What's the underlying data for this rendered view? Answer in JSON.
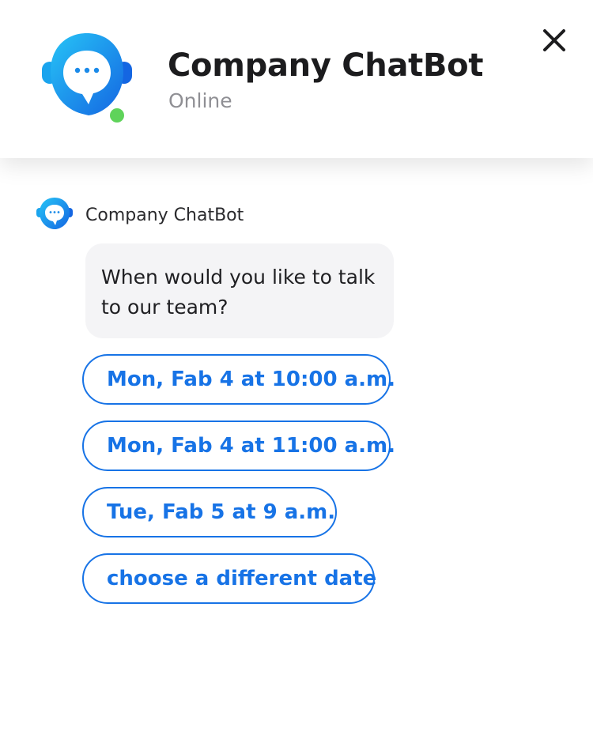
{
  "header": {
    "title": "Company ChatBot",
    "status": "Online",
    "logo_icon": "chatbot-headset-icon",
    "status_color": "#5fd35a",
    "close_icon": "close-icon"
  },
  "chat": {
    "sender": "Company ChatBot",
    "message": "When would you like to talk to our team?",
    "options": [
      {
        "label": "Mon, Fab 4 at 10:00 a.m."
      },
      {
        "label": "Mon, Fab 4 at 11:00 a.m."
      },
      {
        "label": "Tue, Fab 5 at 9 a.m."
      },
      {
        "label": "choose a different date"
      }
    ]
  },
  "colors": {
    "accent": "#1773e6",
    "bubble_bg": "#f4f4f6",
    "logo_light": "#27c2f5",
    "logo_dark": "#1567e3"
  }
}
